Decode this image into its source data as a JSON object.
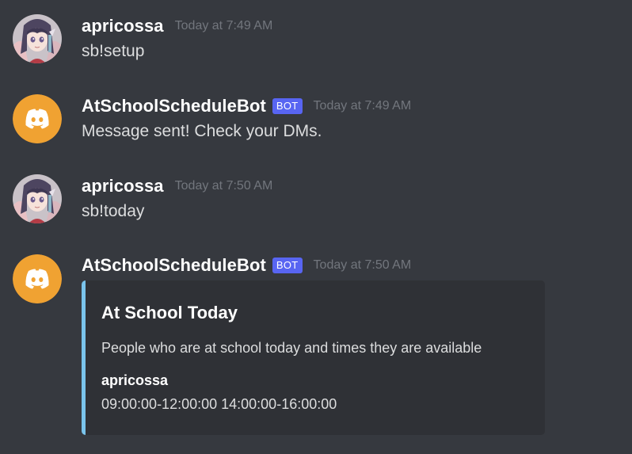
{
  "colors": {
    "background": "#36393f",
    "bot_tag": "#5865f2",
    "bot_avatar": "#f0a232",
    "embed_bar": "#7ac4ec",
    "embed_bg": "#2f3136"
  },
  "messages": [
    {
      "avatar_icon": "anime-girl-avatar-icon",
      "username": "apricossa",
      "timestamp": "Today at 7:49 AM",
      "content": "sb!setup"
    },
    {
      "avatar_icon": "discord-logo-icon",
      "username": "AtSchoolScheduleBot",
      "bot_tag": "BOT",
      "timestamp": "Today at 7:49 AM",
      "content": "Message sent! Check your DMs."
    },
    {
      "avatar_icon": "anime-girl-avatar-icon",
      "username": "apricossa",
      "timestamp": "Today at 7:50 AM",
      "content": "sb!today"
    },
    {
      "avatar_icon": "discord-logo-icon",
      "username": "AtSchoolScheduleBot",
      "bot_tag": "BOT",
      "timestamp": "Today at 7:50 AM",
      "embed": {
        "title": "At School Today",
        "description": "People who are at school today and times they are available",
        "field_name": "apricossa",
        "field_value": "09:00:00-12:00:00 14:00:00-16:00:00"
      }
    }
  ]
}
